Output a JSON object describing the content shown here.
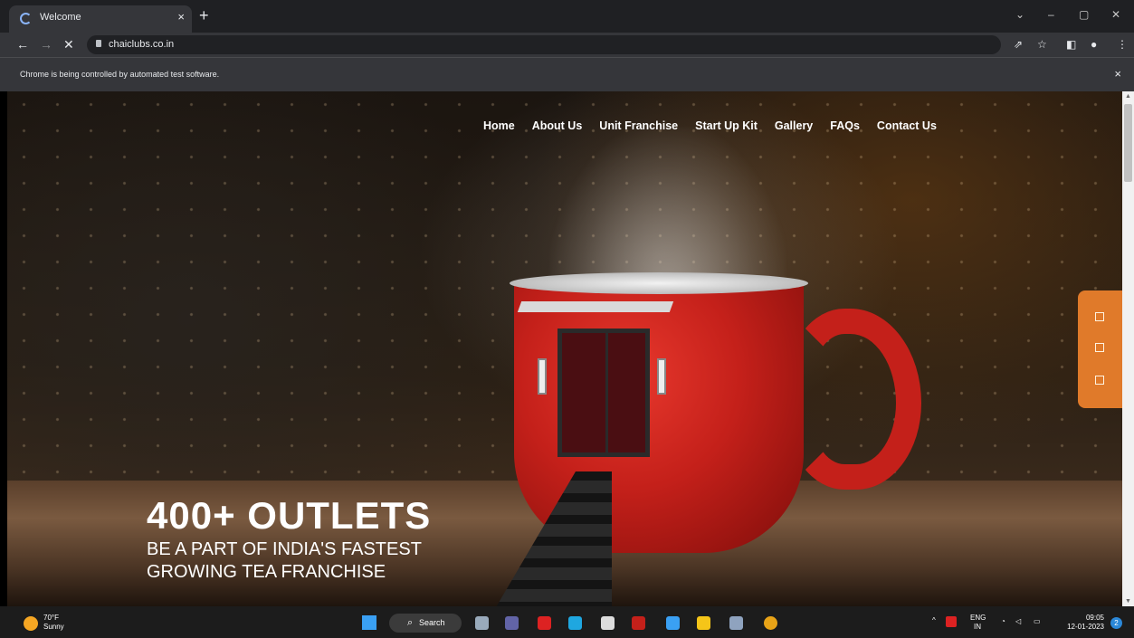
{
  "browser": {
    "tab_title": "Welcome",
    "tab_close": "×",
    "new_tab": "+",
    "url": "chaiclubs.co.in",
    "infobar_text": "Chrome is being controlled by automated test software.",
    "infobar_close": "×",
    "window_controls": {
      "dropdown": "⌄",
      "minimize": "–",
      "restore": "▢",
      "close": "✕"
    },
    "nav": {
      "back": "←",
      "forward": "→",
      "stop": "✕"
    },
    "toolbar_icons": {
      "share": "⇗",
      "star": "☆",
      "sidepanel": "◧",
      "profile": "●",
      "menu": "⋮"
    }
  },
  "site": {
    "menu": [
      {
        "label": "Home"
      },
      {
        "label": "About Us"
      },
      {
        "label": "Unit Franchise"
      },
      {
        "label": "Start Up Kit"
      },
      {
        "label": "Gallery"
      },
      {
        "label": "FAQs"
      },
      {
        "label": "Contact Us"
      }
    ],
    "hero": {
      "headline": "400+ OUTLETS",
      "sub_line1": "BE A PART OF INDIA'S FASTEST",
      "sub_line2": "GROWING TEA FRANCHISE"
    },
    "accent_color": "#e07a2a"
  },
  "taskbar": {
    "weather_temp": "70°F",
    "weather_desc": "Sunny",
    "search_label": "Search",
    "search_icon": "⌕",
    "tray_lang_1": "ENG",
    "tray_lang_2": "IN",
    "time": "09:05",
    "date": "12-01-2023",
    "notif_count": "2"
  }
}
